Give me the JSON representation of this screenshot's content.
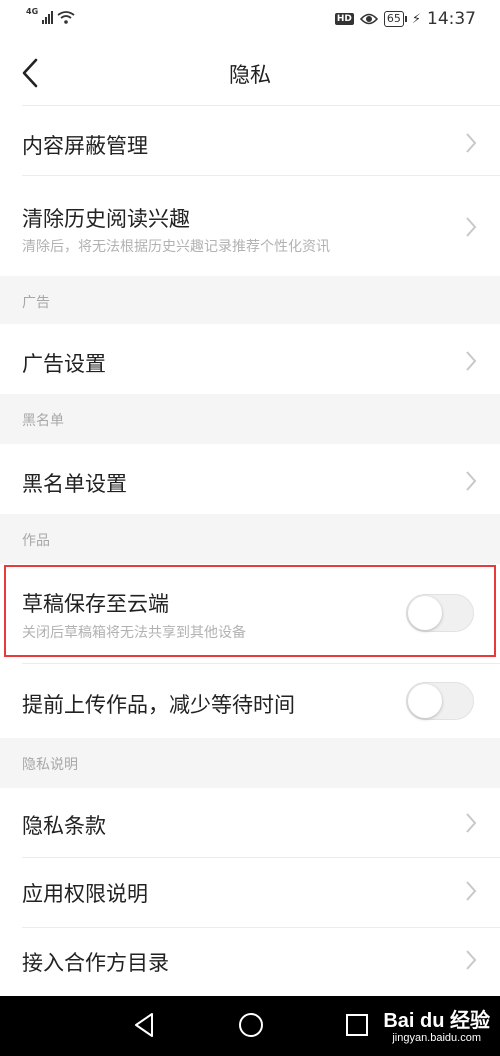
{
  "status_bar": {
    "network": "4G",
    "hd_badge": "HD",
    "battery": "65",
    "time": "14:37"
  },
  "nav": {
    "title": "隐私"
  },
  "rows": {
    "content_block": "内容屏蔽管理",
    "clear_history": "清除历史阅读兴趣",
    "clear_history_sub": "清除后，将无法根据历史兴趣记录推荐个性化资讯",
    "ad_settings": "广告设置",
    "blacklist_settings": "黑名单设置",
    "draft_cloud": "草稿保存至云端",
    "draft_cloud_sub": "关闭后草稿箱将无法共享到其他设备",
    "pre_upload": "提前上传作品，减少等待时间",
    "privacy_terms": "隐私条款",
    "app_permissions": "应用权限说明",
    "partners": "接入合作方目录"
  },
  "sections": {
    "ads": "广告",
    "blacklist": "黑名单",
    "works": "作品",
    "privacy_info": "隐私说明"
  },
  "toggles": {
    "draft_cloud_on": false,
    "pre_upload_on": false
  },
  "watermark": {
    "main": "Bai du 经验",
    "sub": "jingyan.baidu.com"
  },
  "colors": {
    "highlight": "#e83a3a",
    "section_bg": "#f5f5f5",
    "sub_text": "#b2b2b2"
  }
}
